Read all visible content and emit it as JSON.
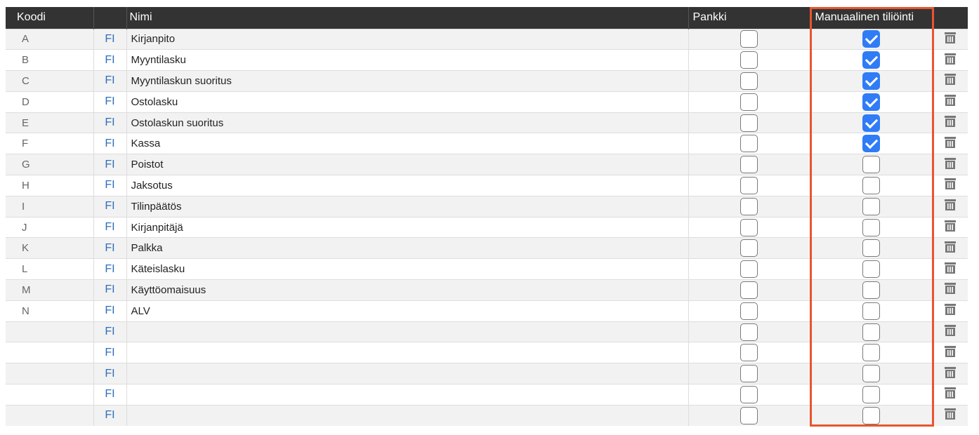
{
  "headers": {
    "code": "Koodi",
    "name": "Nimi",
    "bank": "Pankki",
    "manual": "Manuaalinen tiliöinti"
  },
  "lang_label": "FI",
  "trash_icon": "trash-icon",
  "rows": [
    {
      "code": "A",
      "name": "Kirjanpito",
      "bank": false,
      "manual": true
    },
    {
      "code": "B",
      "name": "Myyntilasku",
      "bank": false,
      "manual": true
    },
    {
      "code": "C",
      "name": "Myyntilaskun suoritus",
      "bank": false,
      "manual": true
    },
    {
      "code": "D",
      "name": "Ostolasku",
      "bank": false,
      "manual": true
    },
    {
      "code": "E",
      "name": "Ostolaskun suoritus",
      "bank": false,
      "manual": true
    },
    {
      "code": "F",
      "name": "Kassa",
      "bank": false,
      "manual": true
    },
    {
      "code": "G",
      "name": "Poistot",
      "bank": false,
      "manual": false
    },
    {
      "code": "H",
      "name": "Jaksotus",
      "bank": false,
      "manual": false
    },
    {
      "code": "I",
      "name": "Tilinpäätös",
      "bank": false,
      "manual": false
    },
    {
      "code": "J",
      "name": "Kirjanpitäjä",
      "bank": false,
      "manual": false
    },
    {
      "code": "K",
      "name": "Palkka",
      "bank": false,
      "manual": false
    },
    {
      "code": "L",
      "name": "Käteislasku",
      "bank": false,
      "manual": false
    },
    {
      "code": "M",
      "name": "Käyttöomaisuus",
      "bank": false,
      "manual": false
    },
    {
      "code": "N",
      "name": "ALV",
      "bank": false,
      "manual": false
    },
    {
      "code": "",
      "name": "",
      "bank": false,
      "manual": false
    },
    {
      "code": "",
      "name": "",
      "bank": false,
      "manual": false
    },
    {
      "code": "",
      "name": "",
      "bank": false,
      "manual": false
    },
    {
      "code": "",
      "name": "",
      "bank": false,
      "manual": false
    },
    {
      "code": "",
      "name": "",
      "bank": false,
      "manual": false
    }
  ],
  "colors": {
    "header_bg": "#333333",
    "checkbox_checked": "#2f7cf6",
    "highlight": "#e8552f",
    "lang_link": "#2f6fbd"
  }
}
